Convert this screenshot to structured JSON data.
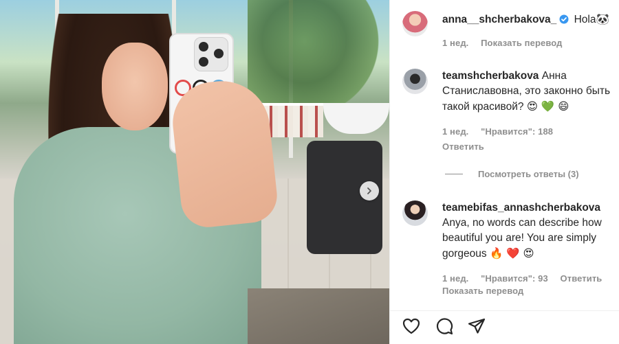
{
  "post": {
    "author": "anna__shcherbakova_",
    "caption": "Hola",
    "caption_emoji": "🐼",
    "time": "1 нед.",
    "show_translation": "Показать перевод"
  },
  "comments": [
    {
      "username": "teamshcherbakova",
      "text": "Анна Станиславовна, это законно быть такой красивой?",
      "emojis": "😍 💚 😄",
      "time": "1 нед.",
      "likes": "\"Нравится\": 188",
      "reply": "Ответить"
    },
    {
      "username": "teamebifas_annashcherbakova",
      "text": "Anya, no words can describe how beautiful you are! You are simply gorgeous",
      "emojis": "🔥 ❤️ 😍",
      "time": "1 нед.",
      "likes": "\"Нравится\": 93",
      "reply": "Ответить",
      "show_translation": "Показать перевод"
    }
  ],
  "view_replies": "Посмотреть ответы (3)",
  "icons": {
    "like": "heart-icon",
    "comment": "comment-icon",
    "share": "share-icon",
    "verified": "verified-badge-icon",
    "carousel_next": "chevron-right-icon"
  },
  "colors": {
    "verified": "#3897f0",
    "meta_text": "#8e8e8e",
    "text": "#262626"
  }
}
